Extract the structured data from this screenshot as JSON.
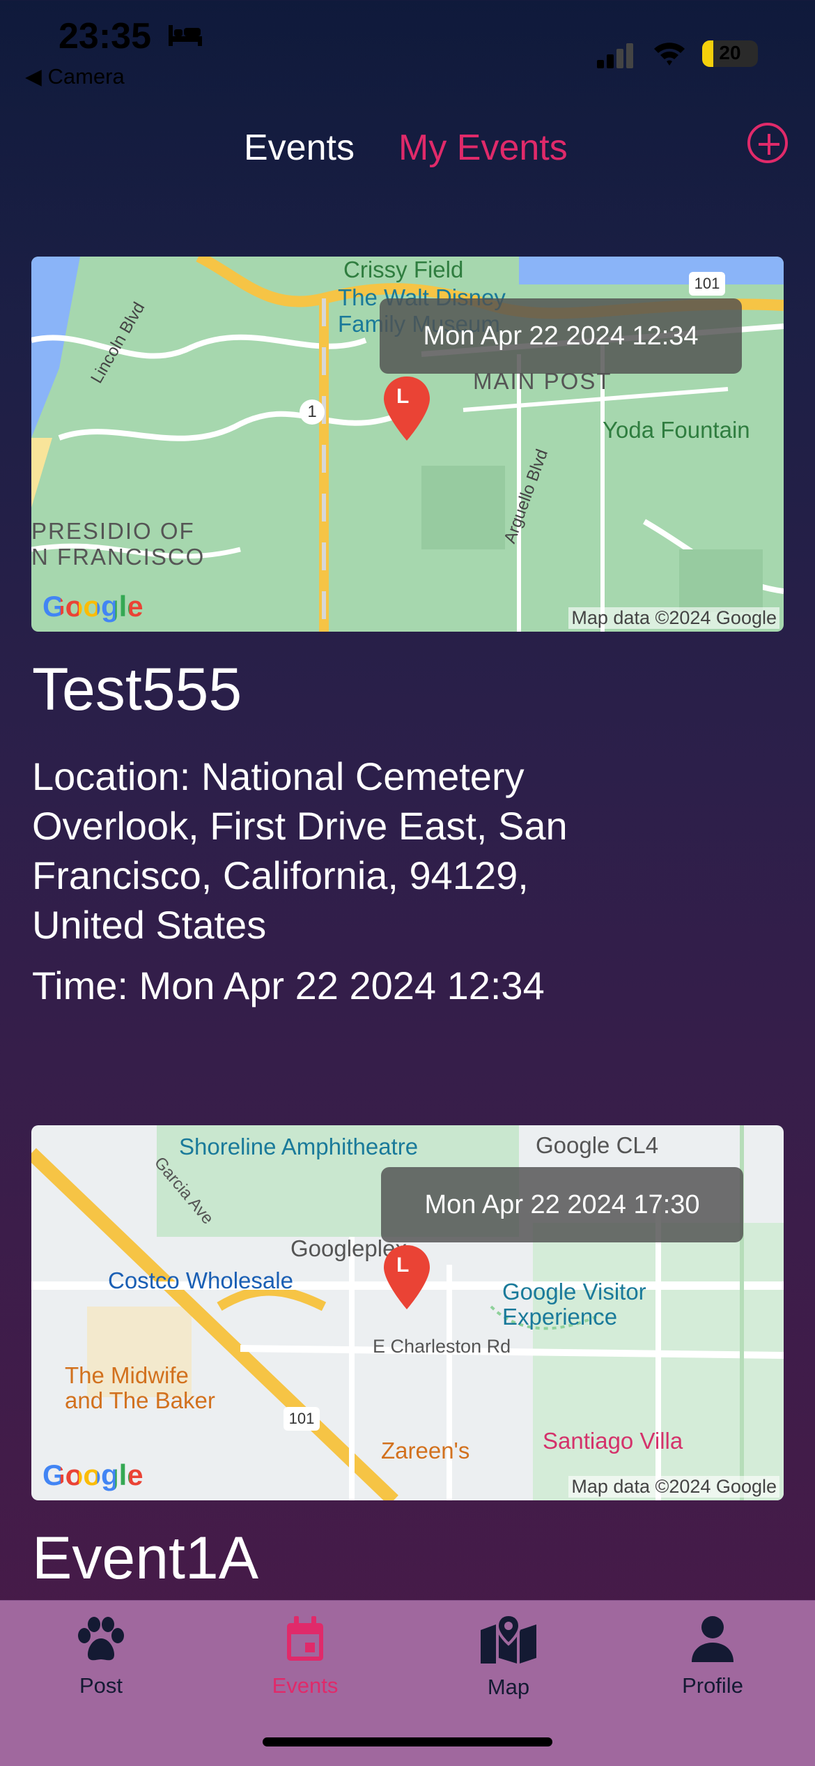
{
  "status_bar": {
    "time": "23:35",
    "back_label": "◀ Camera",
    "battery_level": "20",
    "battery_fraction": 0.2
  },
  "top_tabs": {
    "events": "Events",
    "my_events": "My Events",
    "add_icon": "plus-circle-icon"
  },
  "colors": {
    "accent": "#e02a6a",
    "nav_bg": "#a0689e"
  },
  "events": [
    {
      "map_badge": "Mon Apr 22 2024 12:34",
      "title": "Test555",
      "location": "Location: National Cemetery Overlook, First Drive East, San Francisco, California, 94129, United States",
      "time": "Time: Mon Apr 22 2024 12:34",
      "map_labels": {
        "crissy_field": "Crissy Field",
        "disney1": "The Walt Disney",
        "disney2": "Family Museum",
        "main_post": "MAIN POST",
        "yoda": "Yoda Fountain",
        "lincoln": "Lincoln Blvd",
        "arguello": "Arguello Blvd",
        "presidio1": "PRESIDIO OF",
        "presidio2": "N FRANCISCO",
        "shield_1": "1",
        "shield_101": "101",
        "attribution": "Map data ©2024 Google"
      }
    },
    {
      "map_badge": "Mon Apr 22 2024 17:30",
      "title": "Event1A",
      "map_labels": {
        "shoreline": "Shoreline Amphitheatre",
        "google_cl4": "Google CL4",
        "garcia": "Garcia Ave",
        "googleplex": "Googleplex",
        "costco": "Costco Wholesale",
        "visitor1": "Google Visitor",
        "visitor2": "Experience",
        "charleston": "E Charleston Rd",
        "midwife1": "The Midwife",
        "midwife2": "and The Baker",
        "shield_101": "101",
        "zareens": "Zareen's",
        "santiago": "Santiago Villa",
        "attribution": "Map data ©2024 Google"
      }
    }
  ],
  "map_pin_letter": "L",
  "google_logo": "Google",
  "bottom_nav": [
    {
      "label": "Post",
      "icon": "paw-icon"
    },
    {
      "label": "Events",
      "icon": "calendar-icon",
      "active": true
    },
    {
      "label": "Map",
      "icon": "map-icon"
    },
    {
      "label": "Profile",
      "icon": "person-icon"
    }
  ]
}
